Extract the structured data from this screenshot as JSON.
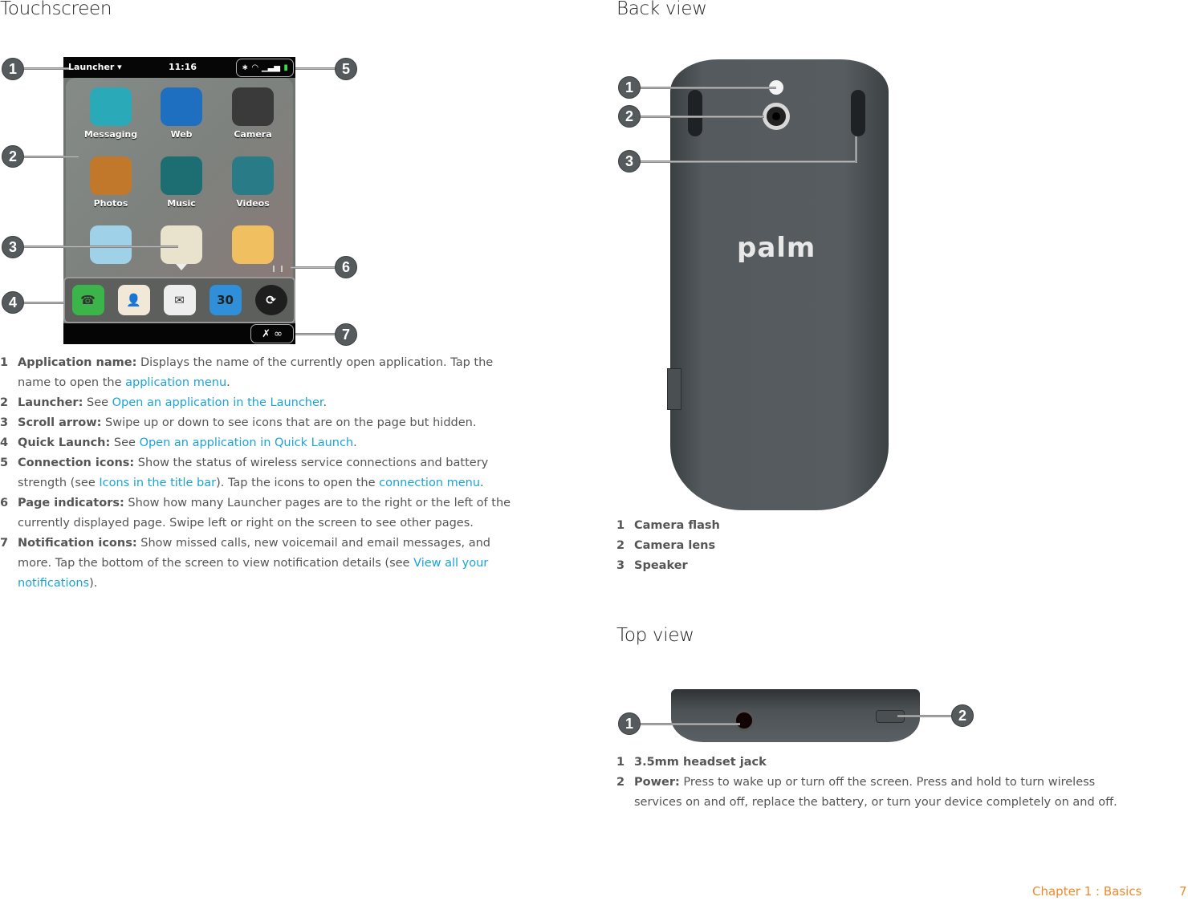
{
  "left": {
    "heading": "Touchscreen",
    "screen": {
      "app_name": "Launcher ▾",
      "time": "11:16",
      "conn_icons": [
        "∗",
        "◠",
        "▁▃▅",
        "▮"
      ],
      "apps": [
        {
          "label": "Messaging",
          "color": "#2aa9b8"
        },
        {
          "label": "Web",
          "color": "#1f6fc0"
        },
        {
          "label": "Camera",
          "color": "#3a3a3a"
        },
        {
          "label": "Photos",
          "color": "#c2782a"
        },
        {
          "label": "Music",
          "color": "#1d6e72"
        },
        {
          "label": "Videos",
          "color": "#2a7b88"
        },
        {
          "label": "",
          "color": "#9fd2e8"
        },
        {
          "label": "",
          "color": "#e9e2cc"
        },
        {
          "label": "",
          "color": "#f0c060"
        }
      ],
      "quick_launch_colors": [
        "#3bb54a",
        "#f2e8d8",
        "#eeeeee",
        "#2f8fd8",
        "#1e1e1e"
      ],
      "quick_launch_glyphs": [
        "☎",
        "👤",
        "✉",
        "30",
        "⟳"
      ],
      "notif_glyph": "✗ ∞"
    },
    "callouts": [
      "1",
      "2",
      "3",
      "4",
      "5",
      "6",
      "7"
    ],
    "items": [
      {
        "num": "1",
        "label": "Application name:",
        "parts": [
          " Displays the name of the currently open application. Tap the name to open the ",
          "application menu",
          "."
        ]
      },
      {
        "num": "2",
        "label": "Launcher:",
        "parts": [
          " See ",
          "Open an application in the Launcher",
          "."
        ]
      },
      {
        "num": "3",
        "label": "Scroll arrow:",
        "parts": [
          " Swipe up or down to see icons that are on the page but hidden."
        ]
      },
      {
        "num": "4",
        "label": "Quick Launch:",
        "parts": [
          " See ",
          "Open an application in Quick Launch",
          "."
        ]
      },
      {
        "num": "5",
        "label": "Connection icons:",
        "parts": [
          " Show the status of wireless service connections and battery strength (see ",
          "Icons in the title bar",
          "). Tap the icons to open the ",
          "connection menu",
          "."
        ]
      },
      {
        "num": "6",
        "label": "Page indicators:",
        "parts": [
          " Show how many Launcher pages are to the right or the left of the currently displayed page. Swipe left or right on the screen to see other pages."
        ]
      },
      {
        "num": "7",
        "label": "Notification icons:",
        "parts": [
          " Show missed calls, new voicemail and email messages, and more. Tap the bottom of the screen to view notification details (see ",
          "View all your notifications",
          ")."
        ]
      }
    ]
  },
  "back": {
    "heading": "Back view",
    "brand": "palm",
    "callouts": [
      "1",
      "2",
      "3"
    ],
    "items": [
      {
        "num": "1",
        "label": "Camera flash"
      },
      {
        "num": "2",
        "label": "Camera lens"
      },
      {
        "num": "3",
        "label": "Speaker"
      }
    ]
  },
  "top": {
    "heading": "Top view",
    "callouts": [
      "1",
      "2"
    ],
    "items": [
      {
        "num": "1",
        "label": "3.5mm headset jack",
        "text": ""
      },
      {
        "num": "2",
        "label": "Power:",
        "text": " Press to wake up or turn off the screen. Press and hold to turn wireless services on and off, replace the battery, or turn your device completely on and off."
      }
    ]
  },
  "footer": {
    "chapter": "Chapter 1  :  Basics",
    "page": "7"
  },
  "colors": {
    "link": "#1ba3d8",
    "footer": "#f0892a"
  }
}
